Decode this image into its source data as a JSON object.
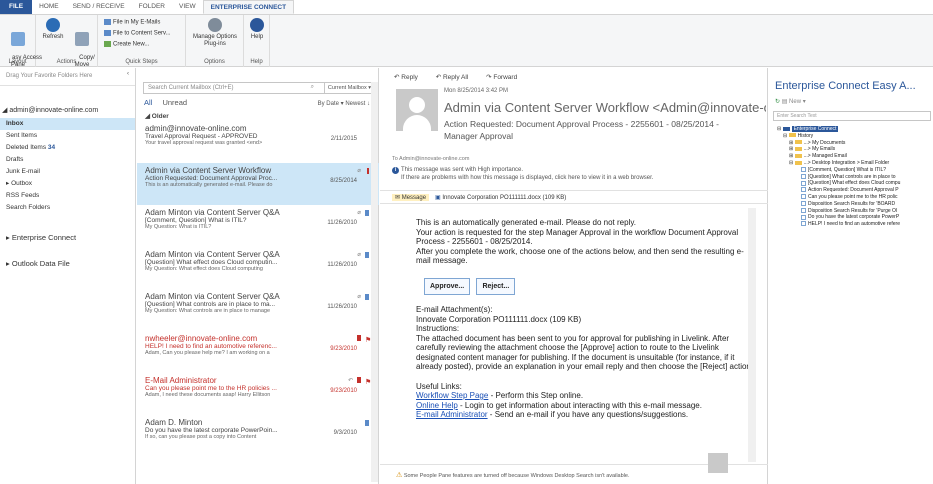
{
  "tabs": [
    "FILE",
    "HOME",
    "SEND / RECEIVE",
    "FOLDER",
    "VIEW",
    "ENTERPRISE CONNECT"
  ],
  "ribbon": {
    "easy_access": "asy Access\nPane",
    "refresh": "Refresh",
    "copy_move": "Copy/\nMove",
    "file_my_emails": "File in My E-Mails",
    "file_content": "File to Content Serv...",
    "create_new": "Create New...",
    "manage_options": "Manage Options",
    "plugins": "Plug-ins",
    "help": "Help",
    "groups": [
      "Layout",
      "Actions",
      "Quick Steps",
      "Options",
      "Help"
    ]
  },
  "nav": {
    "favorites": "Drag Your Favorite Folders Here",
    "account": "admin@innovate-online.com",
    "folders": [
      {
        "label": "Inbox",
        "count": ""
      },
      {
        "label": "Sent Items",
        "count": ""
      },
      {
        "label": "Deleted Items",
        "count": "34"
      },
      {
        "label": "Drafts",
        "count": ""
      },
      {
        "label": "Junk E-mail",
        "count": ""
      },
      {
        "label": "Outbox",
        "count": ""
      },
      {
        "label": "RSS Feeds",
        "count": ""
      },
      {
        "label": "Search Folders",
        "count": ""
      }
    ],
    "enterprise": "Enterprise Connect",
    "outlook_data": "Outlook Data File"
  },
  "list": {
    "search_placeholder": "Search Current Mailbox (Ctrl+E)",
    "scope": "Current Mailbox",
    "filter_all": "All",
    "filter_unread": "Unread",
    "sort": "By Date ▾   Newest ↓",
    "group": "◢ Older",
    "mails": [
      {
        "from": "admin@innovate-online.com",
        "subject": "Travel Approval Request - APPROVED",
        "preview": "Your travel approval request was granted <end>",
        "date": "2/11/2015"
      },
      {
        "from": "Admin via Content Server Workflow",
        "subject": "Action Requested: Document Approval Proc...",
        "preview": "This is an automatically generated e-mail. Please do",
        "date": "8/25/2014"
      },
      {
        "from": "Adam Minton via Content Server Q&A",
        "subject": "[Comment, Question] What is ITIL?",
        "preview": "My Question: What is ITIL?",
        "date": "11/26/2010"
      },
      {
        "from": "Adam Minton via Content Server Q&A",
        "subject": "[Question] What effect does Cloud computin...",
        "preview": "My Question: What effect does Cloud computing",
        "date": "11/26/2010"
      },
      {
        "from": "Adam Minton via Content Server Q&A",
        "subject": "[Question] What controls are in place to ma...",
        "preview": "My Question: What controls are in place to manage",
        "date": "11/26/2010"
      },
      {
        "from": "nwheeler@innovate-online.com",
        "subject": "HELP! I need to find an automotive referenc...",
        "preview": "Adam,  Can you please help me?  I am working on a",
        "date": "9/23/2010"
      },
      {
        "from": "E-Mail Administrator",
        "subject": "Can you please point me to the HR policies ...",
        "preview": "Adam,  I need these documents asap!  Harry Ellitson",
        "date": "9/23/2010"
      },
      {
        "from": "Adam D. Minton",
        "subject": "Do you have the latest corporate PowerPoin...",
        "preview": "If so, can you please post a copy into Content",
        "date": "9/3/2010"
      }
    ]
  },
  "reading": {
    "reply": "Reply",
    "reply_all": "Reply All",
    "forward": "Forward",
    "date": "Mon 8/25/2014 3:42 PM",
    "from": "Admin via Content Server Workflow <Admin@innovate-o",
    "subject": "Action Requested: Document Approval Process - 2255601 - 08/25/2014 - Manager Approval",
    "to": "To   Admin@innovate-online.com",
    "importance1": "This message was sent with High importance.",
    "importance2": "If there are problems with how this message is displayed, click here to view it in a web browser.",
    "att_message": "Message",
    "att_file": "Innovate Corporation PO111111.docx (109 KB)",
    "body1": "This is an automatically generated e-mail. Please do not reply.",
    "body2": "Your action is requested for the step Manager Approval in the workflow Document Approval Process - 2255601 - 08/25/2014.",
    "body3": "After you complete the work, choose one of the actions below, and then send the resulting e-mail message.",
    "approve": "Approve...",
    "reject": "Reject...",
    "attach_label": "E-mail Attachment(s):",
    "attach_file": "Innovate Corporation PO111111.docx (109 KB)",
    "instr_label": "Instructions:",
    "instructions": "The attached document has been sent to you for approval for publishing in Livelink. After carefully reviewing the attachment choose the [Approve] action to route to the Livelink designated content manager for publishing. If the document is unsuitable (for instance, if it already posted), provide an explanation in your email reply and then choose the [Reject] action.",
    "links_label": "Useful Links:",
    "link1": "Workflow Step Page",
    "link1_rest": " - Perform this Step online.",
    "link2": "Online Help",
    "link2_rest": " - Login to get information about interacting with this e-mail message.",
    "link3": "E-mail Administrator",
    "link3_rest": " - Send an e-mail if you have any questions/suggestions.",
    "people_note": "Some People Pane features are turned off because Windows Desktop Search isn't available."
  },
  "ec": {
    "title": "Enterprise Connect Easy A...",
    "new": "New",
    "search_placeholder": "Enter Search Text",
    "tree": [
      {
        "label": "Enterprise Connect",
        "type": "root"
      },
      {
        "label": "History",
        "type": "folder"
      },
      {
        "label": "...> My Documents",
        "type": "folder"
      },
      {
        "label": "...> My Emails",
        "type": "folder"
      },
      {
        "label": "...> Managed Email",
        "type": "folder"
      },
      {
        "label": "...> Desktop Integration > Email Folder",
        "type": "folder"
      },
      {
        "label": "[Comment, Question] What is ITIL?",
        "type": "item"
      },
      {
        "label": "[Question] What controls are in place to",
        "type": "item"
      },
      {
        "label": "[Question] What effect does Cloud compu",
        "type": "item"
      },
      {
        "label": "Action Requested: Document Approval P",
        "type": "item"
      },
      {
        "label": "Can you please point me to the HR polic",
        "type": "item"
      },
      {
        "label": "Disposition Search Results for 'BOARD",
        "type": "item"
      },
      {
        "label": "Disposition Search Results for 'Purge Ol",
        "type": "item"
      },
      {
        "label": "Do you have the latest corporate PowerP",
        "type": "item"
      },
      {
        "label": "HELP! I need to find an automotive refere",
        "type": "item"
      }
    ]
  }
}
